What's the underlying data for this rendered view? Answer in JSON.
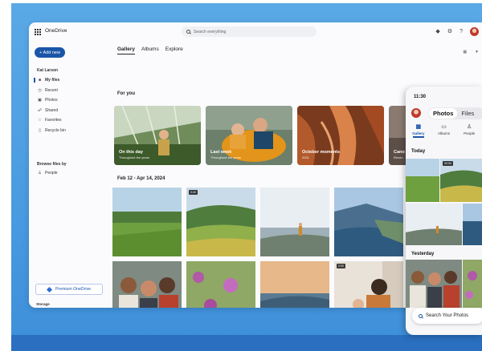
{
  "app": {
    "title": "OneDrive"
  },
  "search": {
    "placeholder": "Search everything"
  },
  "toolbar": {
    "add_new": "+ Add new"
  },
  "sidebar": {
    "user": "Kat Larson",
    "items": [
      {
        "label": "My files",
        "icon": "folder-icon",
        "active": true
      },
      {
        "label": "Recent",
        "icon": "clock-icon"
      },
      {
        "label": "Photos",
        "icon": "image-icon"
      },
      {
        "label": "Shared",
        "icon": "people-icon"
      },
      {
        "label": "Favorites",
        "icon": "star-icon"
      },
      {
        "label": "Recycle bin",
        "icon": "trash-icon"
      }
    ],
    "browse_title": "Browse files by",
    "people_label": "People",
    "premium_label": "Premium OneDrive",
    "storage_label": "Storage"
  },
  "main": {
    "tabs": [
      "Gallery",
      "Albums",
      "Explore"
    ],
    "for_you": "For you",
    "memories": [
      {
        "title": "On this day",
        "subtitle": "Throughout the years"
      },
      {
        "title": "Last week",
        "subtitle": "Throughout the years"
      },
      {
        "title": "October moments",
        "subtitle": "2021"
      },
      {
        "title": "Cano",
        "subtitle": "Recen"
      }
    ],
    "date_range": "Feb 12 - Apr 14, 2024",
    "durations": {
      "video1": "0:40",
      "video2": "2:00"
    }
  },
  "phone": {
    "time": "11:30",
    "seg_on": "Photos",
    "seg_off": "Files",
    "nav": [
      "Gallery",
      "Albums",
      "People"
    ],
    "today": "Today",
    "yesterday": "Yesterday",
    "video_duration": "00:00",
    "search_label": "Search Your Photos"
  },
  "colors": {
    "accent": "#1a56a8",
    "background": "#4a9ae0"
  }
}
